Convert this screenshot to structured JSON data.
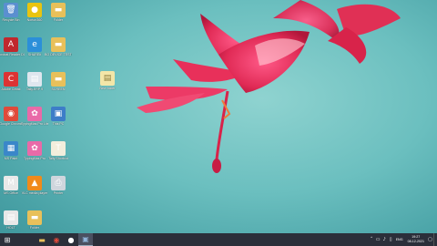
{
  "desktop": {
    "icons": [
      {
        "name": "recycle-bin-icon",
        "glyph": "🗑",
        "color": "#5a8fd0",
        "label": "Recycle Bin"
      },
      {
        "name": "norton-icon",
        "glyph": "●",
        "color": "#e8c410",
        "label": "Norton360"
      },
      {
        "name": "folder-icon",
        "glyph": "▬",
        "color": "#e8c05a",
        "label": "Folder"
      },
      {
        "name": "acrobat-reader-icon",
        "glyph": "A",
        "color": "#c0282d",
        "label": "Acrobat Reader DC"
      },
      {
        "name": "ie-icon",
        "glyph": "e",
        "color": "#2b8fd9",
        "label": "SHAREit"
      },
      {
        "name": "folder-icon",
        "glyph": "▬",
        "color": "#e8c05a",
        "label": "BO DEVICE TESTING"
      },
      {
        "name": "adobe-creative-icon",
        "glyph": "C",
        "color": "#d33",
        "label": "Adobe Creati"
      },
      {
        "name": "document-icon",
        "glyph": "▤",
        "color": "#dfe6ee",
        "label": "Tally.ERP 9"
      },
      {
        "name": "folder-icon",
        "glyph": "▬",
        "color": "#e8c05a",
        "label": "SCREEN"
      },
      {
        "name": "chrome-icon",
        "glyph": "◉",
        "color": "#e04a3a",
        "label": "Google Chrome"
      },
      {
        "name": "typingmaster-icon",
        "glyph": "✿",
        "color": "#e96aa8",
        "label": "TypingMas Pro Lite"
      },
      {
        "name": "computer-icon",
        "glyph": "▣",
        "color": "#3d7dc8",
        "label": "This PC"
      },
      {
        "name": "mspaint-icon",
        "glyph": "▦",
        "color": "#3a87c9",
        "label": "MS Paint"
      },
      {
        "name": "typingmaster2-icon",
        "glyph": "✿",
        "color": "#e96aa8",
        "label": "TypingMas Pro"
      },
      {
        "name": "tally-icon",
        "glyph": "T",
        "color": "#f2eedc",
        "label": "Tally Shortcut"
      },
      {
        "name": "gmail-icon",
        "glyph": "M",
        "color": "#e9e9e9",
        "label": "MS Office"
      },
      {
        "name": "vlc-icon",
        "glyph": "▲",
        "color": "#f08a1a",
        "label": "VLC media player"
      },
      {
        "name": "printer-icon",
        "glyph": "⎙",
        "color": "#cfd6dd",
        "label": "Printer"
      },
      {
        "name": "document2-icon",
        "glyph": "▤",
        "color": "#e8e8e8",
        "label": "HOLT"
      },
      {
        "name": "folder-icon",
        "glyph": "▬",
        "color": "#e8c05a",
        "label": "Folder"
      }
    ],
    "center_file": {
      "glyph": "▤",
      "color": "#f3e6a8",
      "label": "New folder"
    }
  },
  "taskbar": {
    "start": "⊞",
    "buttons": [
      {
        "name": "file-explorer-icon",
        "glyph": "▬",
        "color": "#e8c05a"
      },
      {
        "name": "chrome-taskbar-icon",
        "glyph": "◉",
        "color": "#e04a3a"
      },
      {
        "name": "obs-icon",
        "glyph": "●",
        "color": "#ffffff"
      },
      {
        "name": "screen-recorder-icon",
        "glyph": "▣",
        "color": "#8fb3d8"
      }
    ],
    "tray": {
      "lang": "ENG",
      "time": "19:27",
      "date": "08-12-2021"
    }
  }
}
